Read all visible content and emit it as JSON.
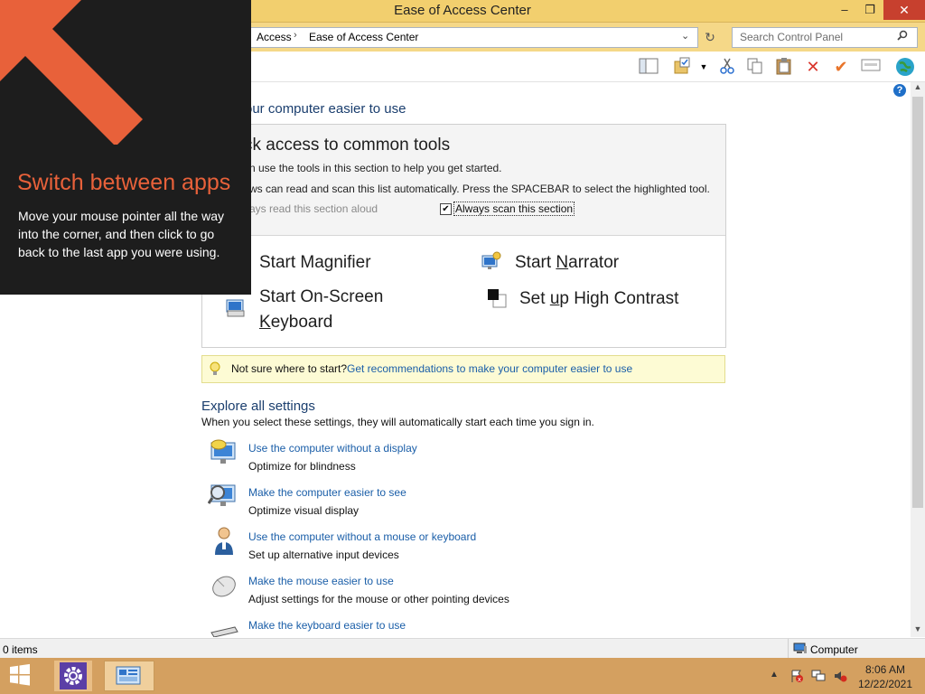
{
  "window": {
    "title": "Ease of Access Center",
    "buttons": {
      "minimize": "–",
      "restore": "❐",
      "close": "✕"
    }
  },
  "address": {
    "crumbs": [
      "Access",
      "Ease of Access Center"
    ],
    "separator": "›",
    "dropdown": "⌄",
    "refresh": "↻"
  },
  "search": {
    "placeholder": "Search Control Panel"
  },
  "toolbar": {
    "icons": [
      "layout-icon",
      "folder-options-icon",
      "cut-icon",
      "copy-icon",
      "paste-icon",
      "delete-icon",
      "check-icon",
      "properties-icon",
      "globe-icon"
    ]
  },
  "help": {
    "label": "?"
  },
  "main": {
    "heading": "our computer easier to use",
    "quick": {
      "title": "ck access to common tools",
      "desc1": "n use the tools in this section to help you get started.",
      "desc2": "ws can read and scan this list automatically.  Press the SPACEBAR to select the highlighted tool.",
      "read_aloud": "ays read this section aloud",
      "scan_label": "Always scan this section",
      "scan_checked": true,
      "checkmark": "✔"
    },
    "tools": {
      "magnifier": {
        "label": "Start Magnifier"
      },
      "narrator": {
        "label_pre": "Start ",
        "label_u": "N",
        "label_post": "arrator"
      },
      "osk": {
        "line1": "Start On-Screen",
        "line2_u": "K",
        "line2_post": "eyboard"
      },
      "contrast": {
        "label_pre": "Set ",
        "label_u": "u",
        "label_post": "p High Contrast"
      }
    },
    "notsure": {
      "text": "Not sure where to start?",
      "link": "Get recommendations to make your computer easier to use"
    },
    "explore": {
      "title": "Explore all settings",
      "desc": "When you select these settings, they will automatically start each time you sign in.",
      "items": [
        {
          "link": "Use the computer without a display",
          "desc": "Optimize for blindness"
        },
        {
          "link": "Make the computer easier to see",
          "desc": "Optimize visual display"
        },
        {
          "link": "Use the computer without a mouse or keyboard",
          "desc": "Set up alternative input devices"
        },
        {
          "link": "Make the mouse easier to use",
          "desc": "Adjust settings for the mouse or other pointing devices"
        },
        {
          "link": "Make the keyboard easier to use",
          "desc": ""
        }
      ]
    }
  },
  "statusbar": {
    "items": "0 items",
    "computer": "Computer"
  },
  "taskbar": {
    "time": "8:06 AM",
    "date": "12/22/2021",
    "tray_up": "▲"
  },
  "overlay": {
    "title": "Switch between apps",
    "desc": "Move your mouse pointer all the way into the corner, and then click to go back to the last app you were using.",
    "arrow_color": "#e8613a"
  },
  "colors": {
    "titlebar": "#f2cf6e",
    "link": "#1a5ea8",
    "taskbar": "#d4a060"
  }
}
